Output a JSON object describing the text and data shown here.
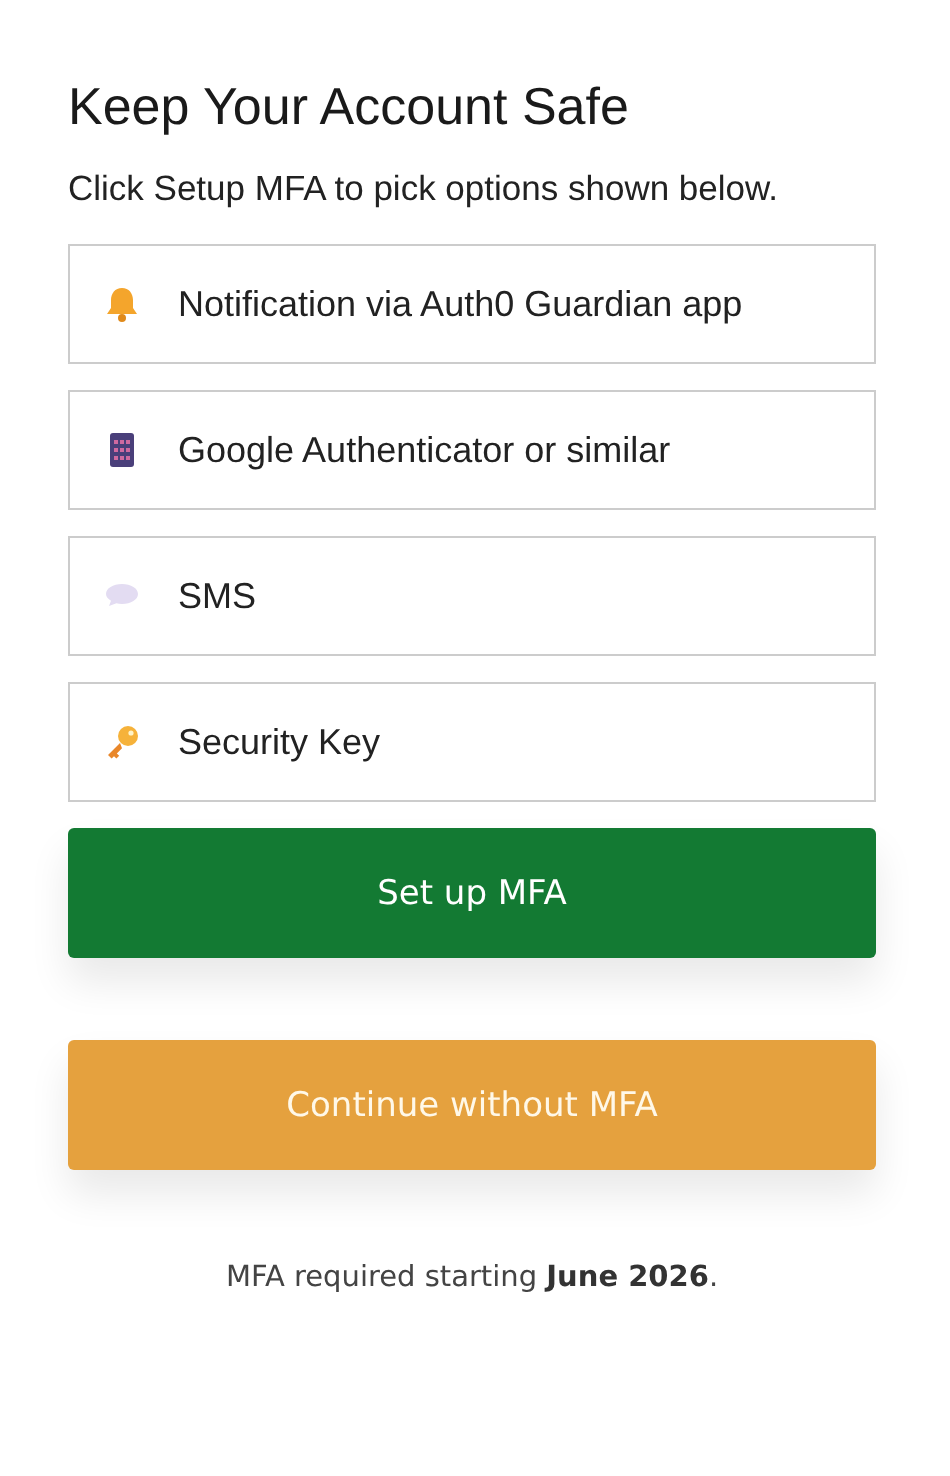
{
  "title": "Keep Your Account Safe",
  "intro": "Click Setup MFA to pick options shown below.",
  "options": [
    {
      "kind": "bell",
      "label": "Notification via Auth0 Guardian app"
    },
    {
      "kind": "calculator",
      "label": "Google Authenticator or similar"
    },
    {
      "kind": "chat",
      "label": "SMS"
    },
    {
      "kind": "key",
      "label": "Security Key"
    }
  ],
  "buttons": [
    {
      "kind": "primary",
      "label": "Set up MFA"
    },
    {
      "kind": "secondary",
      "label": "Continue without MFA"
    }
  ],
  "note": "MFA required starting **June 2026**."
}
